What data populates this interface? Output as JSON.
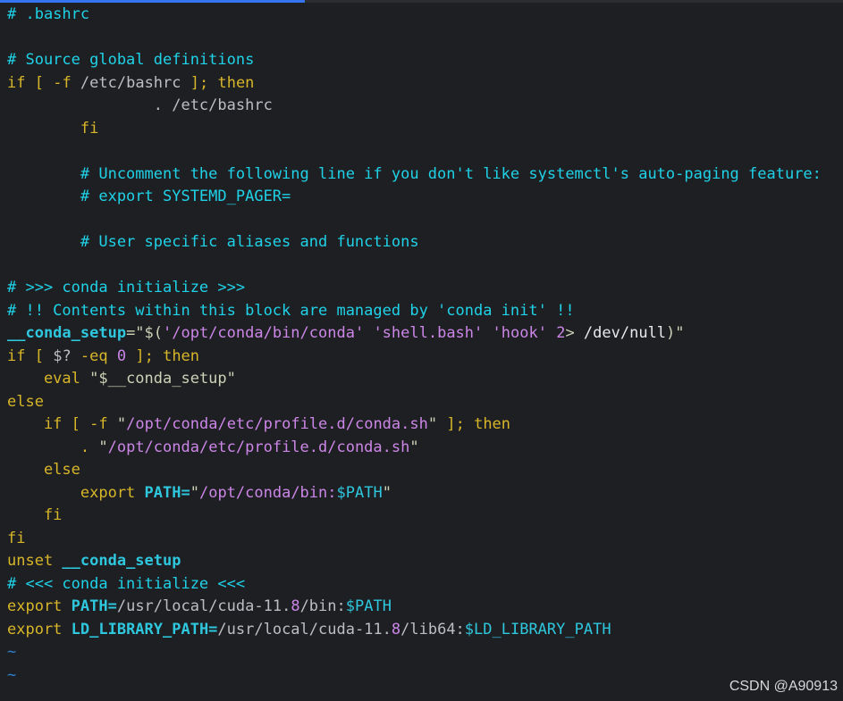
{
  "editor": {
    "lines": [
      [
        {
          "t": "# .bashrc",
          "c": "cmt"
        }
      ],
      [],
      [
        {
          "t": "# Source global definitions",
          "c": "cmt"
        }
      ],
      [
        {
          "t": "if",
          "c": "kw"
        },
        {
          "t": " [ ",
          "c": "kw"
        },
        {
          "t": "-f",
          "c": "kw"
        },
        {
          "t": " /etc/bashrc ",
          "c": "plain"
        },
        {
          "t": "];",
          "c": "kw"
        },
        {
          "t": " then",
          "c": "kw"
        }
      ],
      [
        {
          "t": "                . /etc/bashrc",
          "c": "plain"
        }
      ],
      [
        {
          "t": "        fi",
          "c": "kw"
        }
      ],
      [],
      [
        {
          "t": "        # Uncomment the following line if you don't like systemctl's auto-paging feature:",
          "c": "cmt"
        }
      ],
      [
        {
          "t": "        # export SYSTEMD_PAGER=",
          "c": "cmt"
        }
      ],
      [],
      [
        {
          "t": "        # User specific aliases and functions",
          "c": "cmt"
        }
      ],
      [],
      [
        {
          "t": "# >>> conda initialize >>>",
          "c": "cmt"
        }
      ],
      [
        {
          "t": "# !! Contents within this block are managed by 'conda init' !!",
          "c": "cmt"
        }
      ],
      [
        {
          "t": "__conda_setup",
          "c": "varb"
        },
        {
          "t": "=\"$(",
          "c": "str"
        },
        {
          "t": "'/opt/conda/bin/conda'",
          "c": "path"
        },
        {
          "t": " ",
          "c": "str"
        },
        {
          "t": "'shell.bash'",
          "c": "path"
        },
        {
          "t": " ",
          "c": "str"
        },
        {
          "t": "'hook'",
          "c": "path"
        },
        {
          "t": " ",
          "c": "str"
        },
        {
          "t": "2",
          "c": "num"
        },
        {
          "t": "> ",
          "c": "str"
        },
        {
          "t": "/dev/null",
          "c": "white"
        },
        {
          "t": ")\"",
          "c": "str"
        }
      ],
      [
        {
          "t": "if",
          "c": "kw"
        },
        {
          "t": " [ ",
          "c": "kw"
        },
        {
          "t": "$?",
          "c": "plain"
        },
        {
          "t": " -eq ",
          "c": "kw"
        },
        {
          "t": "0",
          "c": "num"
        },
        {
          "t": " ];",
          "c": "kw"
        },
        {
          "t": " then",
          "c": "kw"
        }
      ],
      [
        {
          "t": "    eval ",
          "c": "kw"
        },
        {
          "t": "\"$__conda_setup\"",
          "c": "str"
        }
      ],
      [
        {
          "t": "else",
          "c": "kw"
        }
      ],
      [
        {
          "t": "    if",
          "c": "kw"
        },
        {
          "t": " [ ",
          "c": "kw"
        },
        {
          "t": "-f",
          "c": "kw"
        },
        {
          "t": " \"",
          "c": "str"
        },
        {
          "t": "/opt/conda/etc/profile.d/conda.sh",
          "c": "path"
        },
        {
          "t": "\" ",
          "c": "str"
        },
        {
          "t": "];",
          "c": "kw"
        },
        {
          "t": " then",
          "c": "kw"
        }
      ],
      [
        {
          "t": "        . ",
          "c": "kw"
        },
        {
          "t": "\"",
          "c": "str"
        },
        {
          "t": "/opt/conda/etc/profile.d/conda.sh",
          "c": "path"
        },
        {
          "t": "\"",
          "c": "str"
        }
      ],
      [
        {
          "t": "    else",
          "c": "kw"
        }
      ],
      [
        {
          "t": "        export ",
          "c": "kw"
        },
        {
          "t": "PATH=",
          "c": "varb"
        },
        {
          "t": "\"",
          "c": "str"
        },
        {
          "t": "/opt/conda/bin:",
          "c": "path"
        },
        {
          "t": "$PATH",
          "c": "var"
        },
        {
          "t": "\"",
          "c": "str"
        }
      ],
      [
        {
          "t": "    fi",
          "c": "kw"
        }
      ],
      [
        {
          "t": "fi",
          "c": "kw"
        }
      ],
      [
        {
          "t": "unset ",
          "c": "kw"
        },
        {
          "t": "__conda_setup",
          "c": "varb"
        }
      ],
      [
        {
          "t": "# <<< conda initialize <<<",
          "c": "cmt"
        }
      ],
      [
        {
          "t": "export ",
          "c": "kw"
        },
        {
          "t": "PATH=",
          "c": "varb"
        },
        {
          "t": "/usr/local/cuda-11.",
          "c": "plain"
        },
        {
          "t": "8",
          "c": "num"
        },
        {
          "t": "/bin:",
          "c": "plain"
        },
        {
          "t": "$PATH",
          "c": "var"
        }
      ],
      [
        {
          "t": "export ",
          "c": "kw"
        },
        {
          "t": "LD_LIBRARY_PATH=",
          "c": "varb"
        },
        {
          "t": "/usr/local/cuda-11.",
          "c": "plain"
        },
        {
          "t": "8",
          "c": "num"
        },
        {
          "t": "/lib64:",
          "c": "plain"
        },
        {
          "t": "$LD_LIBRARY_PATH",
          "c": "var"
        }
      ],
      [
        {
          "t": "~",
          "c": "tilde"
        }
      ],
      [
        {
          "t": "~",
          "c": "tilde"
        }
      ]
    ]
  },
  "watermark": "CSDN @A90913",
  "colors": {
    "background": "#1e1f22",
    "comment": "#1fd2e8",
    "keyword": "#d8b629",
    "variable": "#2ec7de",
    "string": "#cdd1b7",
    "path": "#cc86e8",
    "tilde": "#2d7fd0",
    "accent": "#3574f0"
  }
}
